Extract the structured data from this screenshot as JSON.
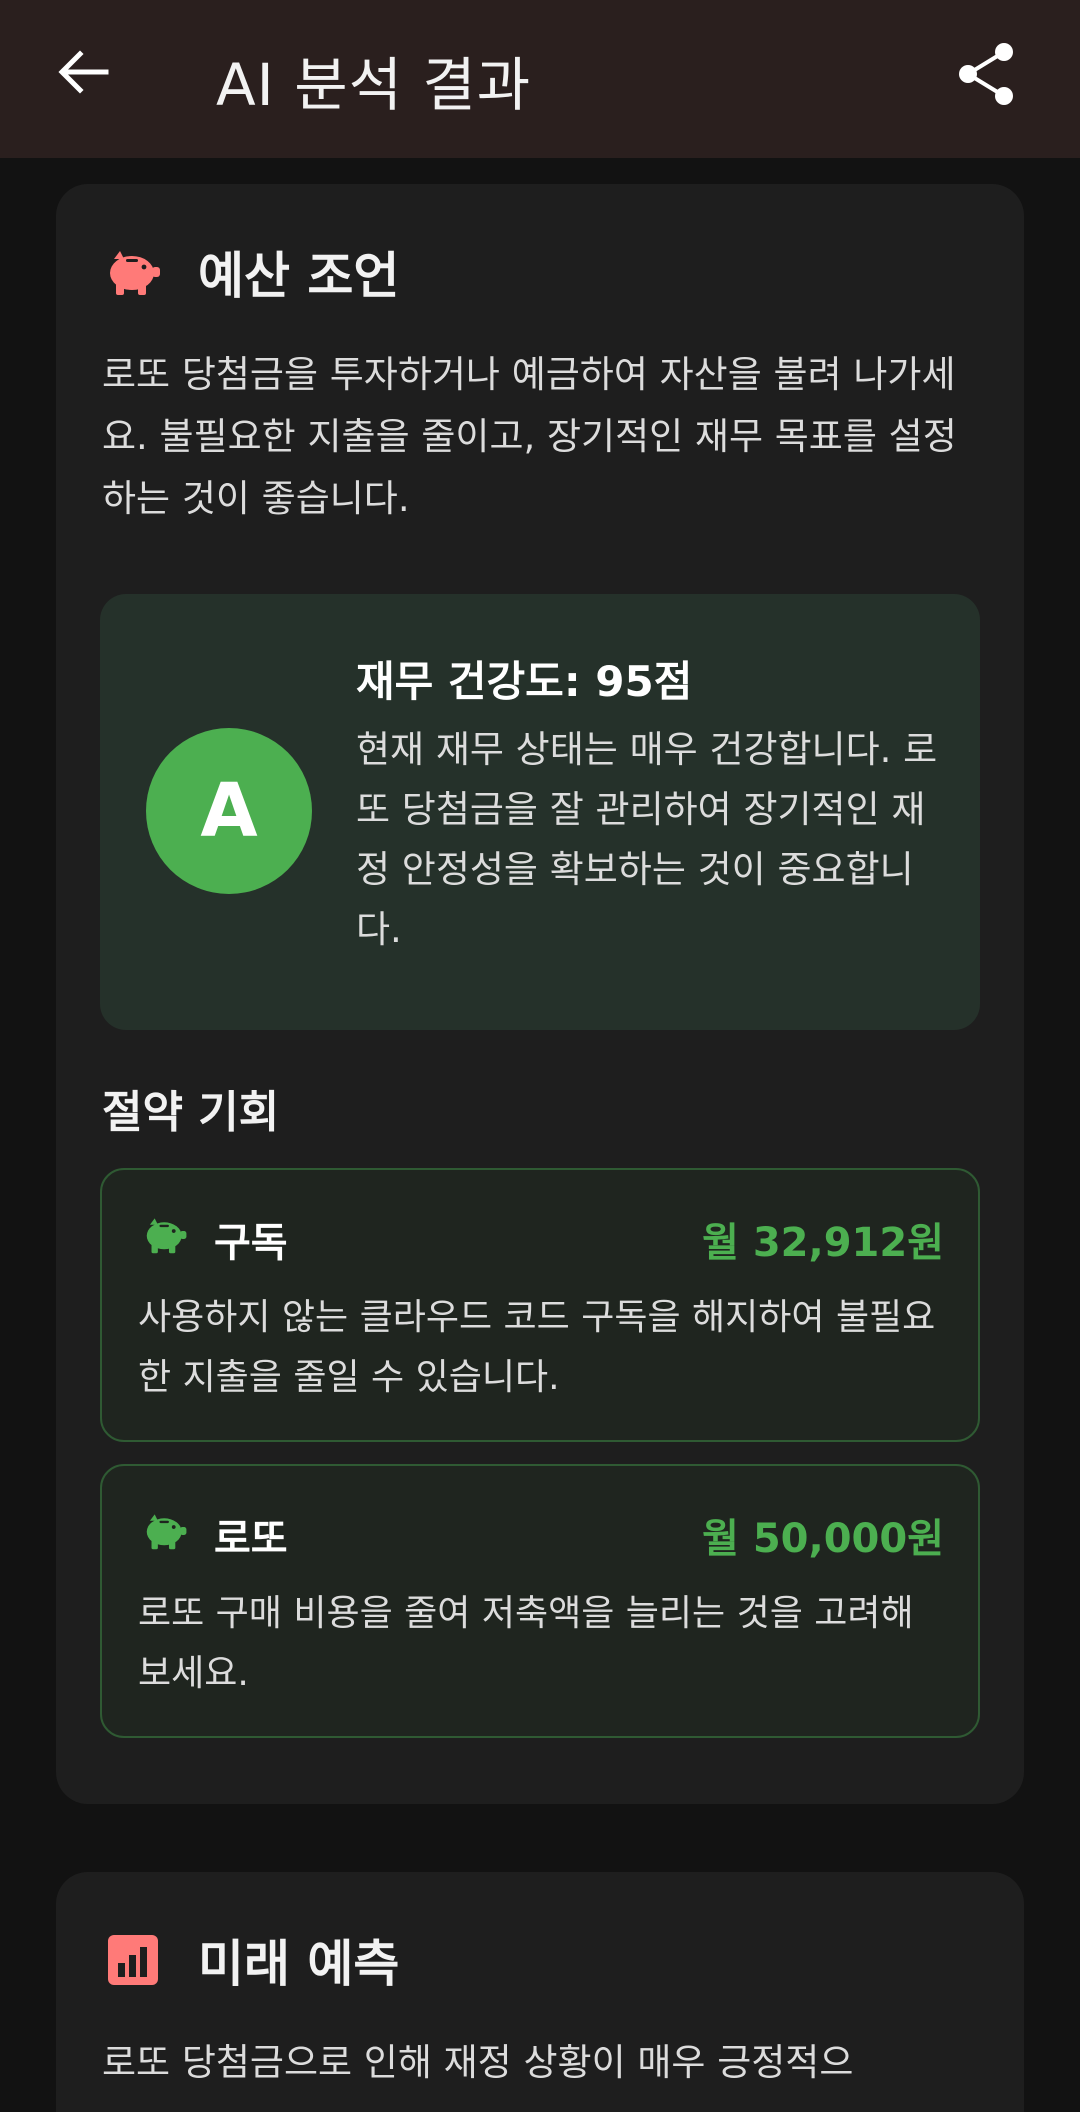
{
  "appbar": {
    "title": "AI 분석 결과",
    "back_icon": "arrow-left-icon",
    "share_icon": "share-icon"
  },
  "budget": {
    "icon": "piggy-bank-icon",
    "title": "예산 조언",
    "advice": "로또 당첨금을 투자하거나 예금하여 자산을 불려 나가세요. 불필요한 지출을 줄이고, 장기적인 재무 목표를 설정하는 것이 좋습니다.",
    "health": {
      "grade": "A",
      "title": "재무 건강도: 95점",
      "description": "현재 재무 상태는 매우 건강합니다. 로또 당첨금을 잘 관리하여 장기적인 재정 안정성을 확보하는 것이 중요합니다."
    },
    "savings_title": "절약 기회",
    "opportunities": [
      {
        "icon": "piggy-bank-icon",
        "name": "구독",
        "amount": "월 32,912원",
        "description": "사용하지 않는 클라우드 코드 구독을 해지하여 불필요한 지출을 줄일 수 있습니다."
      },
      {
        "icon": "piggy-bank-icon",
        "name": "로또",
        "amount": "월 50,000원",
        "description": "로또 구매 비용을 줄여 저축액을 늘리는 것을 고려해 보세요."
      }
    ]
  },
  "forecast": {
    "icon": "bar-chart-icon",
    "title": "미래 예측",
    "text": "로또 당첨금으로 인해 재정 상황이 매우 긍정적으"
  },
  "colors": {
    "appbar_bg": "#2a1f1e",
    "card_bg": "#1e1e1e",
    "accent_red": "#ff7a78",
    "accent_green": "#4caf50",
    "health_bg": "#25312a"
  }
}
